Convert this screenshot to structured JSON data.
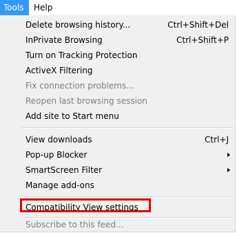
{
  "menubar": {
    "tools_label": "Tools",
    "help_label": "Help"
  },
  "menu": {
    "items": [
      {
        "label": "Delete browsing history...",
        "shortcut": "Ctrl+Shift+Del",
        "enabled": true
      },
      {
        "label": "InPrivate Browsing",
        "shortcut": "Ctrl+Shift+P",
        "enabled": true
      },
      {
        "label": "Turn on Tracking Protection",
        "shortcut": "",
        "enabled": true
      },
      {
        "label": "ActiveX Filtering",
        "shortcut": "",
        "enabled": true
      },
      {
        "label": "Fix connection problems...",
        "shortcut": "",
        "enabled": false
      },
      {
        "label": "Reopen last browsing session",
        "shortcut": "",
        "enabled": false
      },
      {
        "label": "Add site to Start menu",
        "shortcut": "",
        "enabled": true
      },
      {
        "label": "View downloads",
        "shortcut": "Ctrl+J",
        "enabled": true
      },
      {
        "label": "Pop-up Blocker",
        "shortcut": "",
        "enabled": true,
        "submenu": true
      },
      {
        "label": "SmartScreen Filter",
        "shortcut": "",
        "enabled": true,
        "submenu": true
      },
      {
        "label": "Manage add-ons",
        "shortcut": "",
        "enabled": true
      },
      {
        "label": "Compatibility View settings",
        "shortcut": "",
        "enabled": true,
        "highlighted": true
      },
      {
        "label": "Subscribe to this feed...",
        "shortcut": "",
        "enabled": false
      }
    ]
  },
  "colors": {
    "menubar_selected_bg": "#3399ff",
    "menu_bg": "#f0f0f0",
    "disabled_text": "#7f7f7f",
    "highlight_border": "#e00000"
  }
}
